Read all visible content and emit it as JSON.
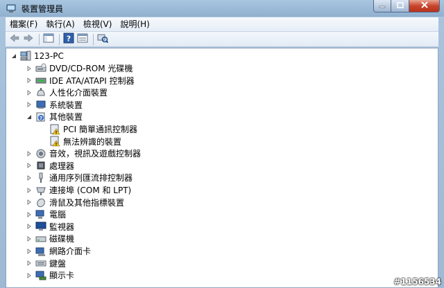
{
  "window": {
    "title": "裝置管理員"
  },
  "menu": [
    {
      "label": "檔案(F)"
    },
    {
      "label": "執行(A)"
    },
    {
      "label": "檢視(V)"
    },
    {
      "label": "說明(H)"
    }
  ],
  "tree": {
    "root": "123-PC",
    "items": [
      {
        "label": "DVD/CD-ROM 光碟機",
        "icon": "dvd-drive-icon",
        "level": 1,
        "expander": "collapsed"
      },
      {
        "label": "IDE ATA/ATAPI 控制器",
        "icon": "ide-controller-icon",
        "level": 1,
        "expander": "collapsed"
      },
      {
        "label": "人性化介面裝置",
        "icon": "hid-icon",
        "level": 1,
        "expander": "collapsed"
      },
      {
        "label": "系統裝置",
        "icon": "system-device-icon",
        "level": 1,
        "expander": "collapsed"
      },
      {
        "label": "其他裝置",
        "icon": "other-device-icon",
        "level": 1,
        "expander": "expanded"
      },
      {
        "label": "PCI 簡單通訊控制器",
        "icon": "warning-device-icon",
        "level": 2,
        "expander": "none"
      },
      {
        "label": "無法辨識的裝置",
        "icon": "warning-device-icon",
        "level": 2,
        "expander": "none"
      },
      {
        "label": "音效，視訊及遊戲控制器",
        "icon": "sound-icon",
        "level": 1,
        "expander": "collapsed"
      },
      {
        "label": "處理器",
        "icon": "processor-icon",
        "level": 1,
        "expander": "collapsed"
      },
      {
        "label": "通用序列匯流排控制器",
        "icon": "usb-icon",
        "level": 1,
        "expander": "collapsed"
      },
      {
        "label": "連接埠 (COM 和 LPT)",
        "icon": "port-icon",
        "level": 1,
        "expander": "collapsed"
      },
      {
        "label": "滑鼠及其他指標裝置",
        "icon": "mouse-icon",
        "level": 1,
        "expander": "collapsed"
      },
      {
        "label": "電腦",
        "icon": "computer-icon",
        "level": 1,
        "expander": "collapsed"
      },
      {
        "label": "監視器",
        "icon": "monitor-icon",
        "level": 1,
        "expander": "collapsed"
      },
      {
        "label": "磁碟機",
        "icon": "disk-drive-icon",
        "level": 1,
        "expander": "collapsed"
      },
      {
        "label": "網路介面卡",
        "icon": "network-adapter-icon",
        "level": 1,
        "expander": "collapsed"
      },
      {
        "label": "鍵盤",
        "icon": "keyboard-icon",
        "level": 1,
        "expander": "collapsed"
      },
      {
        "label": "顯示卡",
        "icon": "display-adapter-icon",
        "level": 1,
        "expander": "collapsed"
      }
    ]
  },
  "watermark": "#1156534"
}
